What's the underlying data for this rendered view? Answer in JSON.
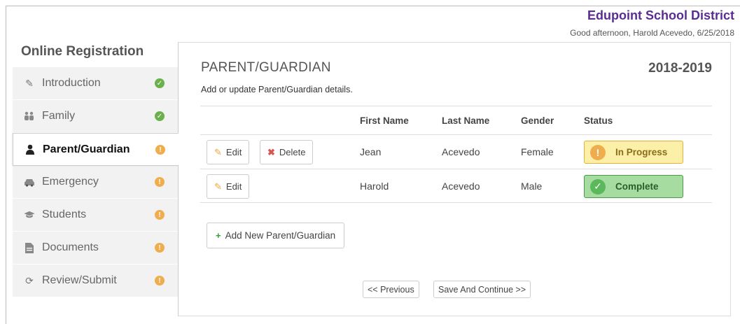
{
  "header": {
    "brand": "Edupoint School District",
    "greeting": "Good afternoon, Harold Acevedo, 6/25/2018"
  },
  "app_title": "Online Registration",
  "sidebar": {
    "items": [
      {
        "label": "Introduction",
        "icon": "pencil-icon",
        "status": "complete"
      },
      {
        "label": "Family",
        "icon": "family-icon",
        "status": "complete"
      },
      {
        "label": "Parent/Guardian",
        "icon": "user-icon",
        "status": "incomplete",
        "active": true
      },
      {
        "label": "Emergency",
        "icon": "car-icon",
        "status": "incomplete"
      },
      {
        "label": "Students",
        "icon": "graduation-cap-icon",
        "status": "incomplete"
      },
      {
        "label": "Documents",
        "icon": "document-icon",
        "status": "incomplete"
      },
      {
        "label": "Review/Submit",
        "icon": "refresh-icon",
        "status": "incomplete"
      }
    ]
  },
  "section": {
    "title": "PARENT/GUARDIAN",
    "school_year": "2018-2019",
    "subtitle": "Add or update Parent/Guardian details."
  },
  "table": {
    "columns": [
      "First Name",
      "Last Name",
      "Gender",
      "Status"
    ],
    "rows": [
      {
        "first": "Jean",
        "last": "Acevedo",
        "gender": "Female",
        "status": "In Progress",
        "edit_label": "Edit",
        "delete_label": "Delete"
      },
      {
        "first": "Harold",
        "last": "Acevedo",
        "gender": "Male",
        "status": "Complete",
        "edit_label": "Edit"
      }
    ]
  },
  "buttons": {
    "add": "Add New Parent/Guardian",
    "previous": "<< Previous",
    "next": "Save And Continue >>"
  },
  "colors": {
    "brand": "#5b2c91",
    "complete": "#5cb85c",
    "in_progress": "#f0ad4e"
  }
}
